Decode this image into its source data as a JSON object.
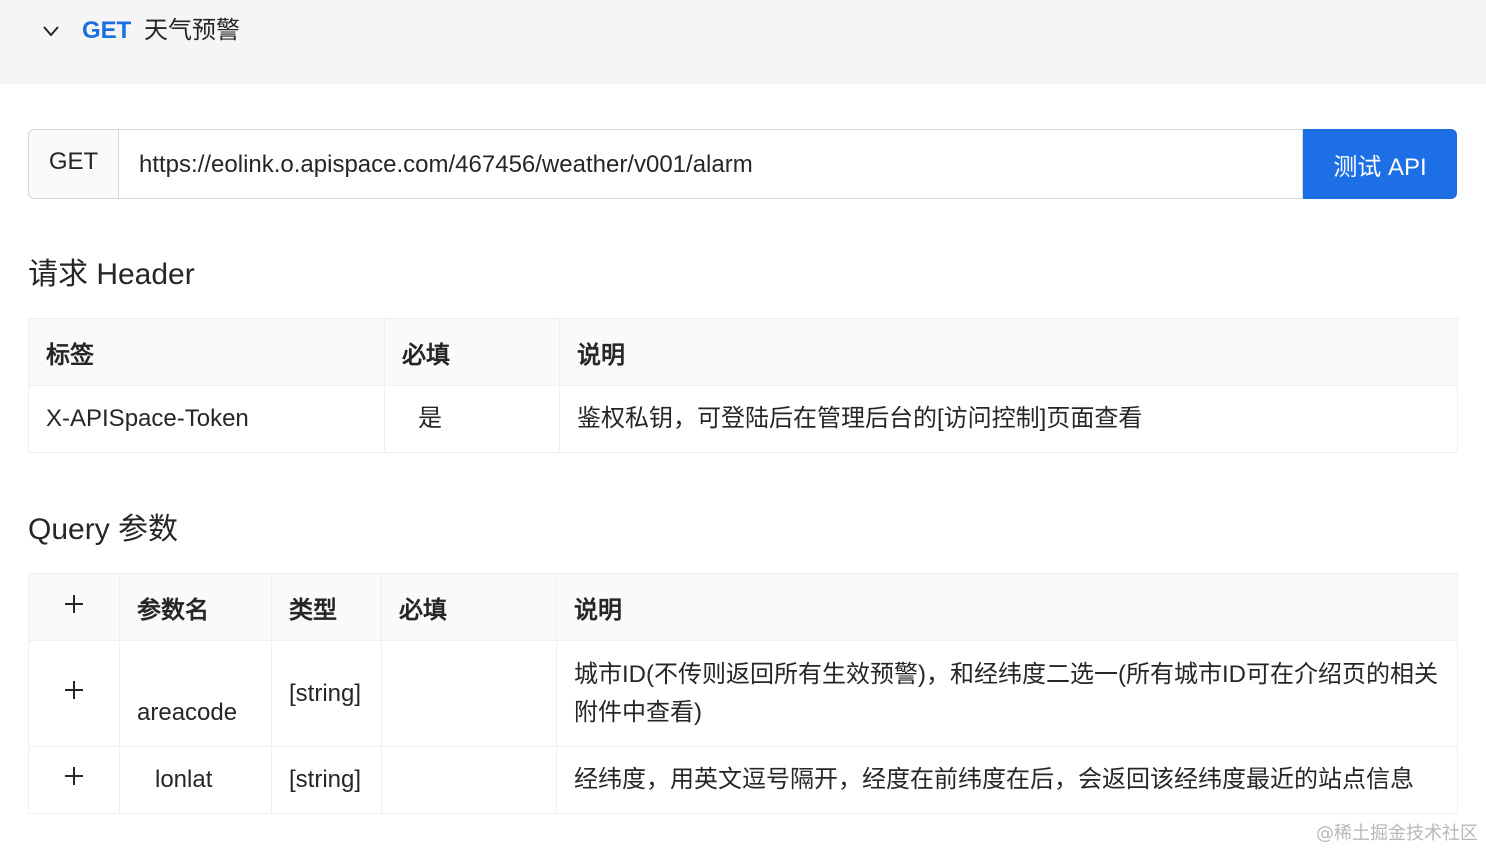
{
  "header": {
    "method": "GET",
    "api_name": "天气预警"
  },
  "url_bar": {
    "method": "GET",
    "url": "https://eolink.o.apispace.com/467456/weather/v001/alarm",
    "test_button": "测试 API"
  },
  "request_header": {
    "title": "请求 Header",
    "columns": [
      "标签",
      "必填",
      "说明"
    ],
    "rows": [
      {
        "label": "X-APISpace-Token",
        "required": "是",
        "description": "鉴权私钥，可登陆后在管理后台的[访问控制]页面查看"
      }
    ]
  },
  "query_params": {
    "title": "Query 参数",
    "columns": [
      "参数名",
      "类型",
      "必填",
      "说明"
    ],
    "rows": [
      {
        "name": "areacode",
        "type": "[string]",
        "required": "",
        "description": "城市ID(不传则返回所有生效预警)，和经纬度二选一(所有城市ID可在介绍页的相关附件中查看)"
      },
      {
        "name": "lonlat",
        "type": "[string]",
        "required": "",
        "description": "经纬度，用英文逗号隔开，经度在前纬度在后，会返回该经纬度最近的站点信息"
      }
    ]
  },
  "watermark": "@稀土掘金技术社区",
  "colors": {
    "accent": "#1d6fe6",
    "method_tag": "#1b6fe0"
  }
}
